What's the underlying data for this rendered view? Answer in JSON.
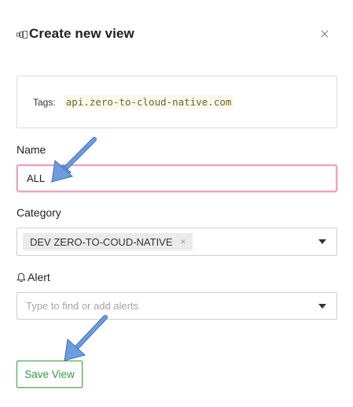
{
  "dialog": {
    "title": "Create new view",
    "close_label": "×"
  },
  "tags": {
    "label": "Tags:",
    "value": "api.zero-to-cloud-native.com"
  },
  "name_field": {
    "label": "Name",
    "value": "ALL"
  },
  "category_field": {
    "label": "Category",
    "selected_chip": "DEV ZERO-TO-COUD-NATIVE",
    "chip_remove": "×"
  },
  "alert_field": {
    "label": "Alert",
    "placeholder": "Type to find or add alerts"
  },
  "actions": {
    "save_label": "Save View"
  },
  "annotations": {
    "arrow_color": "#5b8fd9"
  },
  "colors": {
    "focus_border": "#e8a5c3",
    "save_green": "#2f9e44"
  }
}
